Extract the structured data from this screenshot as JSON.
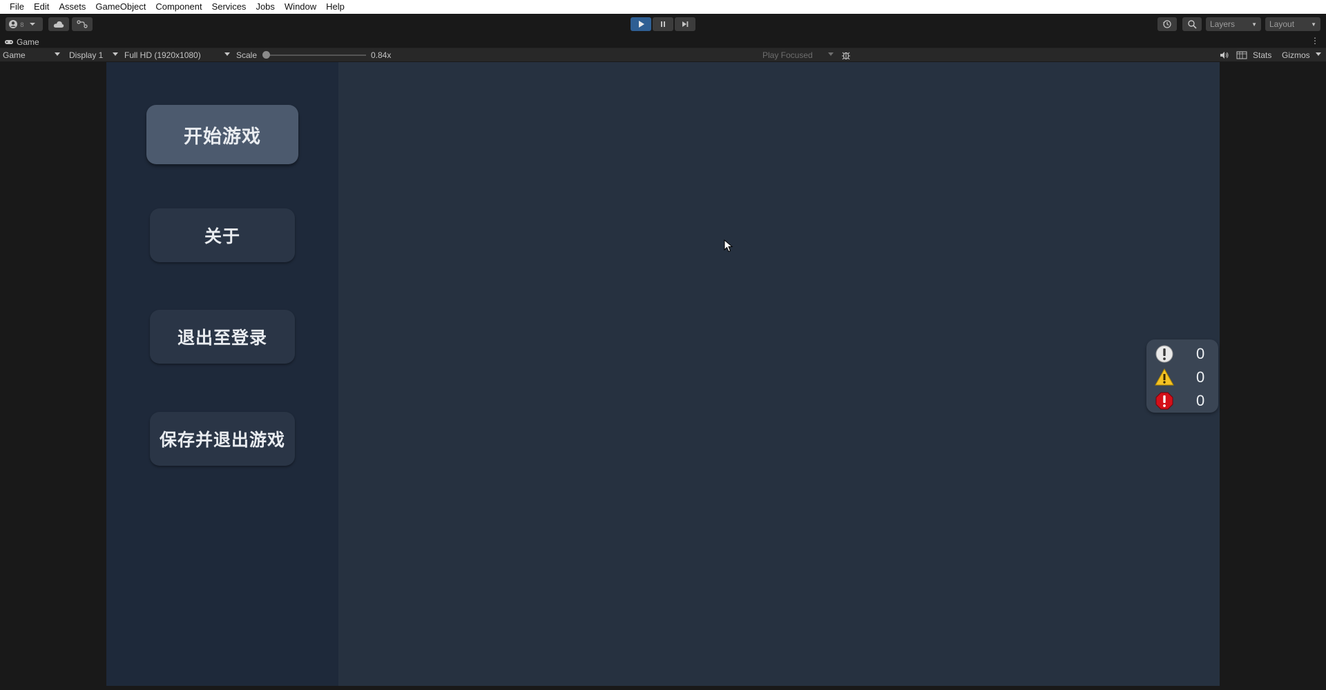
{
  "menubar": {
    "items": [
      "File",
      "Edit",
      "Assets",
      "GameObject",
      "Component",
      "Services",
      "Jobs",
      "Window",
      "Help"
    ]
  },
  "toolbar": {
    "account_icon": "account-icon",
    "cloud_icon": "cloud-icon",
    "collab_icon": "collab-icon",
    "play_icon": "play-icon",
    "pause_icon": "pause-icon",
    "step_icon": "step-icon",
    "history_icon": "history-icon",
    "search_icon": "search-icon",
    "layers_label": "Layers",
    "layout_label": "Layout",
    "accent_color": "#2f5f93"
  },
  "tab": {
    "title": "Game",
    "icon": "gamepad-icon"
  },
  "gamebar": {
    "view_mode": "Game",
    "display": "Display 1",
    "resolution": "Full HD (1920x1080)",
    "scale_label": "Scale",
    "scale_value": "0.84x",
    "scale_fraction": 0.0,
    "play_mode": "Play Focused",
    "bug_icon": "bug-icon",
    "audio_icon": "speaker-icon",
    "stats_label": "Stats",
    "gizmos_label": "Gizmos"
  },
  "game": {
    "buttons": [
      {
        "label": "开始游戏"
      },
      {
        "label": "关于"
      },
      {
        "label": "退出至登录"
      },
      {
        "label": "保存并退出游戏"
      }
    ],
    "console": {
      "info_count": "0",
      "warning_count": "0",
      "error_count": "0"
    },
    "colors": {
      "canvas": "#263140",
      "panel": "#1e293a",
      "button": "#2a3546",
      "button_primary": "#4c5a6e"
    }
  }
}
